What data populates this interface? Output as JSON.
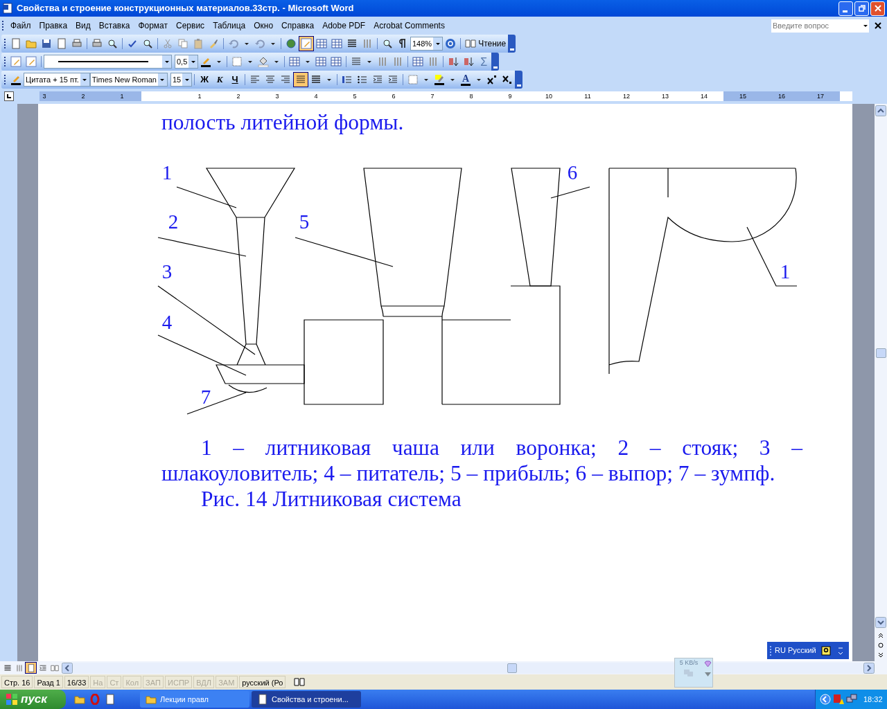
{
  "window": {
    "title": "Свойства и строение конструкционных материалов.33стр. - Microsoft Word"
  },
  "menu": [
    "Файл",
    "Правка",
    "Вид",
    "Вставка",
    "Формат",
    "Сервис",
    "Таблица",
    "Окно",
    "Справка",
    "Adobe PDF",
    "Acrobat Comments"
  ],
  "help_box": {
    "placeholder": "Введите вопрос"
  },
  "toolbar_standard": {
    "drawing_on": true,
    "zoom": "148%",
    "reading_button": "Чтение"
  },
  "toolbar_tables": {
    "line_weight": "0,5",
    "sum_symbol": "Σ"
  },
  "toolbar_formatting": {
    "style": "Цитата + 15 пт.",
    "font": "Times New Roman",
    "size": "15",
    "format_buttons": [
      "Ж",
      "К",
      "Ч"
    ],
    "alignments": [
      {
        "selected": false
      },
      {
        "selected": false
      },
      {
        "selected": false
      },
      {
        "selected": true
      }
    ],
    "font_color_letter": "A"
  },
  "ruler": {
    "ticks": [
      {
        "label": "3",
        "margin": true
      },
      {
        "label": "2",
        "margin": true
      },
      {
        "label": "1",
        "margin": true
      },
      {
        "margin": false
      },
      {
        "label": "1",
        "margin": false
      },
      {
        "label": "2",
        "margin": false
      },
      {
        "label": "3",
        "margin": false
      },
      {
        "label": "4",
        "margin": false
      },
      {
        "label": "5",
        "margin": false
      },
      {
        "label": "6",
        "margin": false
      },
      {
        "label": "7",
        "margin": false
      },
      {
        "label": "8",
        "margin": false
      },
      {
        "label": "9",
        "margin": false
      },
      {
        "label": "10",
        "margin": false
      },
      {
        "label": "11",
        "margin": false
      },
      {
        "label": "12",
        "margin": false
      },
      {
        "label": "13",
        "margin": false
      },
      {
        "label": "14",
        "margin": false
      },
      {
        "label": "15",
        "margin": true
      },
      {
        "label": "16",
        "margin": true
      },
      {
        "label": "17",
        "margin": true
      }
    ]
  },
  "document": {
    "top_text": "полость литейной формы.",
    "figure_labels": [
      "1",
      "2",
      "3",
      "4",
      "7",
      "5",
      "6",
      "1"
    ],
    "legend": "1 – литниковая чаша или воронка; 2 – стояк; 3 – шлакоуловитель; 4 – питатель; 5 – прибыль; 6 – выпор; 7 – зумпф.",
    "caption": "Рис. 14 Литниковая система"
  },
  "language_bar": {
    "label": "RU Русский"
  },
  "network_widget": {
    "speed": "5 KB/s"
  },
  "view_buttons": [
    {
      "selected": false
    },
    {
      "selected": false
    },
    {
      "selected": true
    },
    {
      "selected": false
    },
    {
      "selected": false
    }
  ],
  "status_bar": [
    {
      "text": "Стр. 16",
      "disabled": false
    },
    {
      "text": "Разд 1",
      "disabled": false
    },
    {
      "text": "16/33",
      "disabled": false
    },
    {
      "text": "На",
      "disabled": true
    },
    {
      "text": "Ст",
      "disabled": true
    },
    {
      "text": "Кол",
      "disabled": true
    },
    {
      "text": "ЗАП",
      "disabled": true
    },
    {
      "text": "ИСПР",
      "disabled": true
    },
    {
      "text": "ВДЛ",
      "disabled": true
    },
    {
      "text": "ЗАМ",
      "disabled": true
    },
    {
      "text": "русский (Ро",
      "disabled": false
    }
  ],
  "taskbar": {
    "start": "пуск",
    "windows": [
      {
        "label": "Лекции правл",
        "selected": false
      },
      {
        "label": "Свойства и строени...",
        "selected": true
      }
    ],
    "clock": "18:32"
  }
}
